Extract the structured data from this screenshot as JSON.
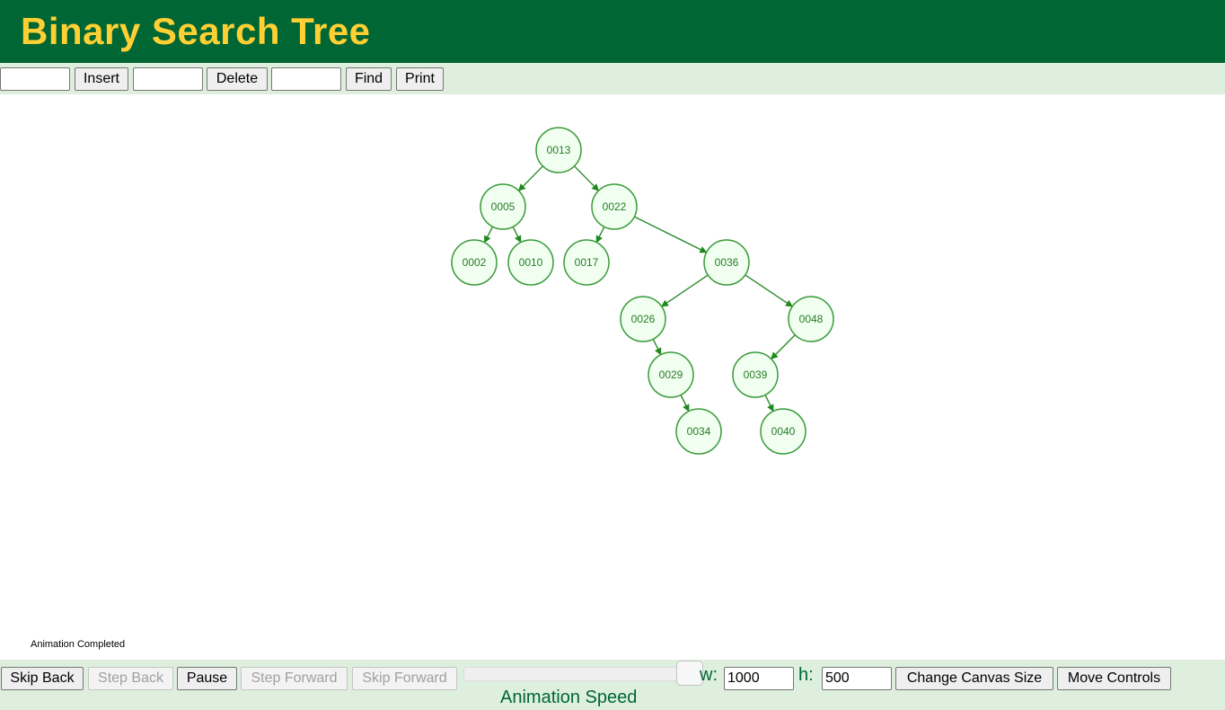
{
  "header": {
    "title": "Binary Search Tree"
  },
  "toolbar": {
    "insert_input_value": "",
    "insert_label": "Insert",
    "delete_input_value": "",
    "delete_label": "Delete",
    "find_input_value": "",
    "find_label": "Find",
    "print_label": "Print"
  },
  "tree": {
    "nodes": [
      {
        "id": "n13",
        "label": "0013"
      },
      {
        "id": "n05",
        "label": "0005"
      },
      {
        "id": "n22",
        "label": "0022"
      },
      {
        "id": "n02",
        "label": "0002"
      },
      {
        "id": "n10",
        "label": "0010"
      },
      {
        "id": "n17",
        "label": "0017"
      },
      {
        "id": "n36",
        "label": "0036"
      },
      {
        "id": "n26",
        "label": "0026"
      },
      {
        "id": "n48",
        "label": "0048"
      },
      {
        "id": "n29",
        "label": "0029"
      },
      {
        "id": "n39",
        "label": "0039"
      },
      {
        "id": "n34",
        "label": "0034"
      },
      {
        "id": "n40",
        "label": "0040"
      }
    ],
    "edges": [
      [
        "n13",
        "n05"
      ],
      [
        "n13",
        "n22"
      ],
      [
        "n05",
        "n02"
      ],
      [
        "n05",
        "n10"
      ],
      [
        "n22",
        "n17"
      ],
      [
        "n22",
        "n36"
      ],
      [
        "n36",
        "n26"
      ],
      [
        "n36",
        "n48"
      ],
      [
        "n26",
        "n29"
      ],
      [
        "n29",
        "n34"
      ],
      [
        "n48",
        "n39"
      ],
      [
        "n39",
        "n40"
      ]
    ]
  },
  "status": {
    "message": "Animation Completed"
  },
  "controls": {
    "skip_back_label": "Skip Back",
    "step_back_label": "Step Back",
    "pause_label": "Pause",
    "step_forward_label": "Step Forward",
    "skip_forward_label": "Skip Forward",
    "speed_label": "Animation Speed",
    "width_label": "w:",
    "width_value": "1000",
    "height_label": "h:",
    "height_value": "500",
    "change_canvas_label": "Change Canvas Size",
    "move_controls_label": "Move Controls"
  },
  "colors": {
    "header_bg": "#006633",
    "title_color": "#ffd033",
    "panel_bg": "#deefde",
    "node_fill": "#f0fff0",
    "node_stroke": "#3a9a3a",
    "edge_color": "#2a8a2a"
  }
}
